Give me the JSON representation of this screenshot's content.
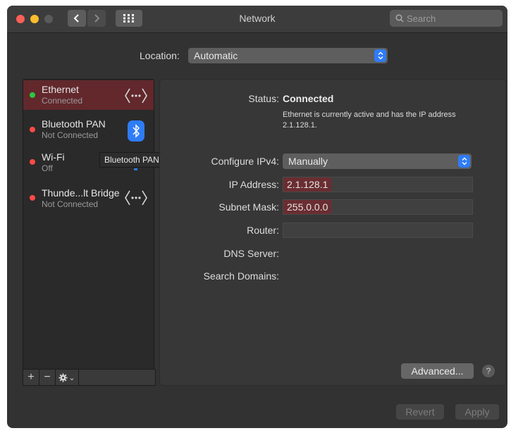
{
  "window": {
    "title": "Network",
    "search_placeholder": "Search"
  },
  "location": {
    "label": "Location:",
    "value": "Automatic"
  },
  "services": [
    {
      "name": "Ethernet",
      "status": "Connected",
      "dot_color": "#2ac840",
      "icon": "ethernet-arrows-icon",
      "selected": true
    },
    {
      "name": "Bluetooth PAN",
      "status": "Not Connected",
      "dot_color": "#ff4a45",
      "icon": "bluetooth-icon",
      "selected": false
    },
    {
      "name": "Wi-Fi",
      "status": "Off",
      "dot_color": "#ff4a45",
      "icon": "wifi-icon",
      "selected": false
    },
    {
      "name": "Thunde...lt Bridge",
      "status": "Not Connected",
      "dot_color": "#ff4a45",
      "icon": "ethernet-arrows-icon",
      "selected": false
    }
  ],
  "tooltip": "Bluetooth PAN",
  "sidebar_footer": {
    "add": "+",
    "remove": "−",
    "chevron": "⌄"
  },
  "details": {
    "status_label": "Status:",
    "status_value": "Connected",
    "status_description": "Ethernet is currently active and has the IP address 2.1.128.1.",
    "configure_label": "Configure IPv4:",
    "configure_value": "Manually",
    "ip_label": "IP Address:",
    "ip_value": "2.1.128.1",
    "subnet_label": "Subnet Mask:",
    "subnet_value": "255.0.0.0",
    "router_label": "Router:",
    "router_value": "",
    "dns_label": "DNS Server:",
    "search_domains_label": "Search Domains:"
  },
  "buttons": {
    "advanced": "Advanced...",
    "help": "?",
    "revert": "Revert",
    "apply": "Apply"
  },
  "colors": {
    "accent": "#2f7cf6",
    "selection_highlight": "#62282c",
    "connected": "#2ac840",
    "not_connected": "#ff4a45"
  }
}
